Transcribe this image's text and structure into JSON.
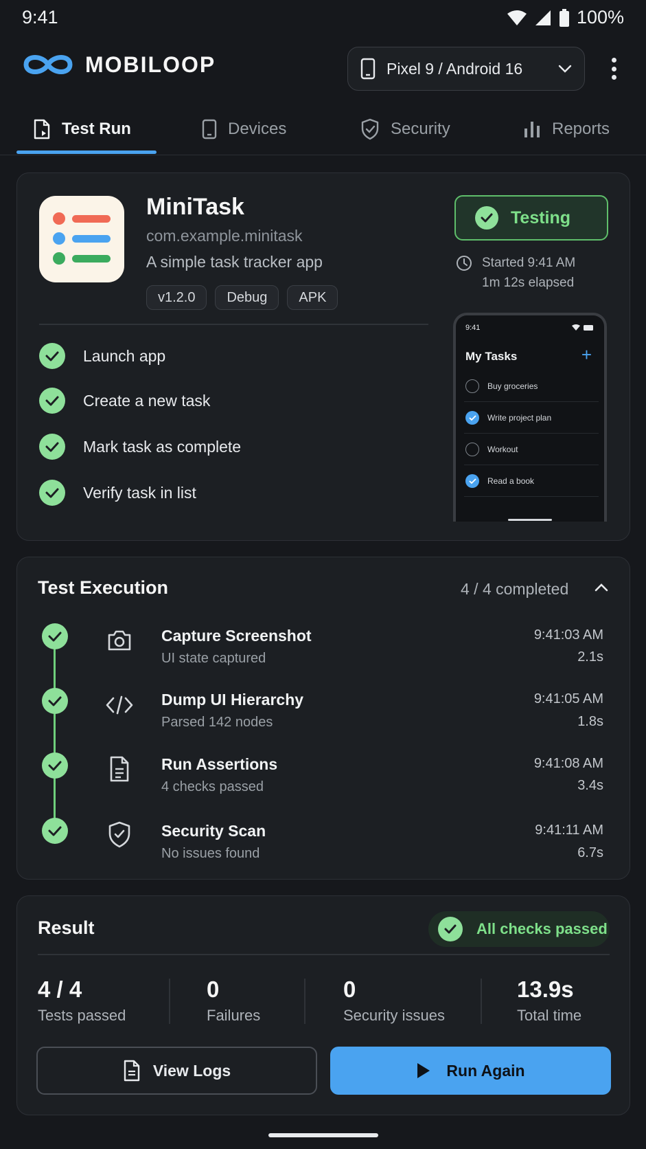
{
  "status_bar": {
    "time": "9:41",
    "battery": "100%"
  },
  "header": {
    "brand": "MOBILOOP",
    "device_selector": "Pixel 9 / Android 16"
  },
  "tabs": [
    {
      "label": "Test Run",
      "active": true,
      "icon": "test-run-icon"
    },
    {
      "label": "Devices",
      "active": false,
      "icon": "phone-icon"
    },
    {
      "label": "Security",
      "active": false,
      "icon": "shield-icon"
    },
    {
      "label": "Reports",
      "active": false,
      "icon": "bar-chart-icon"
    }
  ],
  "app": {
    "name": "MiniTask",
    "package": "com.example.minitask",
    "description": "A simple task tracker app",
    "chips": [
      "v1.2.0",
      "Debug",
      "APK"
    ],
    "status": "Testing",
    "started": "Started 9:41 AM",
    "elapsed": "1m 12s elapsed",
    "steps": [
      "Launch app",
      "Create a new task",
      "Mark task as complete",
      "Verify task in list"
    ]
  },
  "preview": {
    "time": "9:41",
    "title": "My Tasks",
    "tasks": [
      {
        "label": "Buy groceries",
        "done": false
      },
      {
        "label": "Write project plan",
        "done": true
      },
      {
        "label": "Workout",
        "done": false
      },
      {
        "label": "Read a book",
        "done": true
      }
    ]
  },
  "execution": {
    "title": "Test Execution",
    "count": "4 / 4 completed",
    "items": [
      {
        "name": "Capture Screenshot",
        "sub": "UI state captured",
        "time": "9:41:03 AM",
        "duration": "2.1s",
        "icon": "camera-icon"
      },
      {
        "name": "Dump UI Hierarchy",
        "sub": "Parsed 142 nodes",
        "time": "9:41:05 AM",
        "duration": "1.8s",
        "icon": "code-icon"
      },
      {
        "name": "Run Assertions",
        "sub": "4 checks passed",
        "time": "9:41:08 AM",
        "duration": "3.4s",
        "icon": "document-icon"
      },
      {
        "name": "Security Scan",
        "sub": "No issues found",
        "time": "9:41:11 AM",
        "duration": "6.7s",
        "icon": "shield-check-icon"
      }
    ]
  },
  "result": {
    "title": "Result",
    "badge": "All checks passed",
    "stats": [
      {
        "value": "4 / 4",
        "label": "Tests passed"
      },
      {
        "value": "0",
        "label": "Failures"
      },
      {
        "value": "0",
        "label": "Security issues"
      },
      {
        "value": "13.9s",
        "label": "Total time"
      }
    ],
    "view_logs": "View Logs",
    "run_again": "Run Again"
  },
  "colors": {
    "background": "#16181c",
    "accent": "#4aa3f0",
    "success": "#7ee08a"
  }
}
